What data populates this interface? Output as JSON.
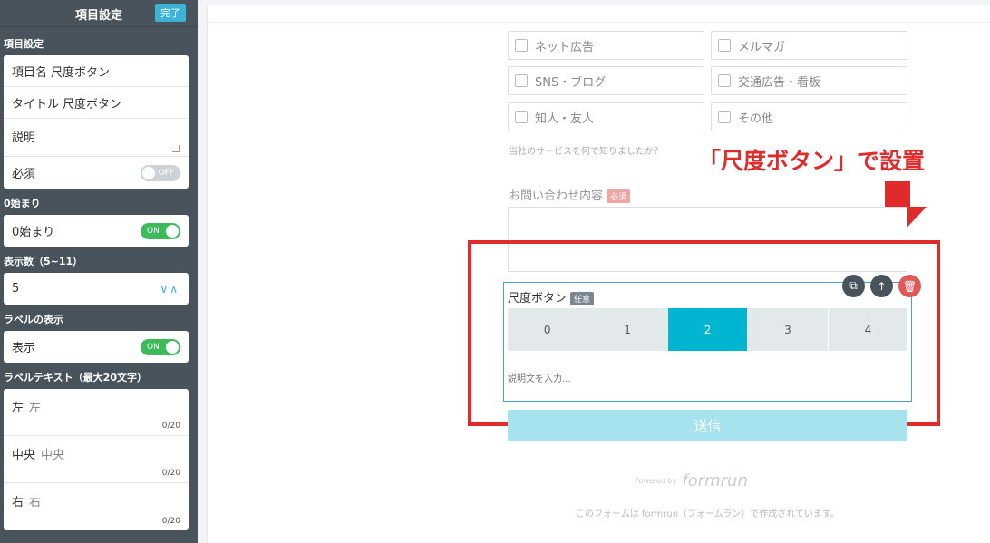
{
  "sidebar": {
    "title": "項目設定",
    "done_label": "完了",
    "section_item": "項目設定",
    "item_name_label": "項目名",
    "item_name_value": "尺度ボタン",
    "title_label": "タイトル",
    "title_value": "尺度ボタン",
    "description_label": "説明",
    "required_label": "必須",
    "required_toggle": "OFF",
    "section_zero": "0始まり",
    "zero_label": "0始まり",
    "zero_toggle": "ON",
    "section_count": "表示数（5~11）",
    "count_value": "5",
    "count_arrows": "∨∧",
    "section_label_display": "ラベルの表示",
    "label_display_label": "表示",
    "label_display_toggle": "ON",
    "section_label_text": "ラベルテキスト（最大20文字）",
    "label_texts": [
      {
        "label": "左",
        "placeholder": "左",
        "counter": "0/20"
      },
      {
        "label": "中央",
        "placeholder": "中央",
        "counter": "0/20"
      },
      {
        "label": "右",
        "placeholder": "右",
        "counter": "0/20"
      }
    ]
  },
  "form": {
    "checkboxes": [
      "ネット広告",
      "メルマガ",
      "SNS・ブログ",
      "交通広告・看板",
      "知人・友人",
      "その他"
    ],
    "help_text": "当社のサービスを何で知りましたか？",
    "inquiry_label": "お問い合わせ内容",
    "required_badge": "必須",
    "scale_title": "尺度ボタン",
    "optional_badge": "任意",
    "scale_options": [
      "0",
      "1",
      "2",
      "3",
      "4"
    ],
    "scale_selected": "2",
    "description_placeholder": "説明文を入力...",
    "submit_label": "送信",
    "powered_by": "Powered by",
    "brand": "formrun",
    "footer": "このフォームは formrun（フォームラン）で作成されています。"
  },
  "annotation": {
    "text": "「尺度ボタン」で設置",
    "color": "#e02b2b"
  },
  "colors": {
    "sidebar_bg": "#48535c",
    "accent": "#00b5cf",
    "toggle_on": "#3dbb5b"
  }
}
